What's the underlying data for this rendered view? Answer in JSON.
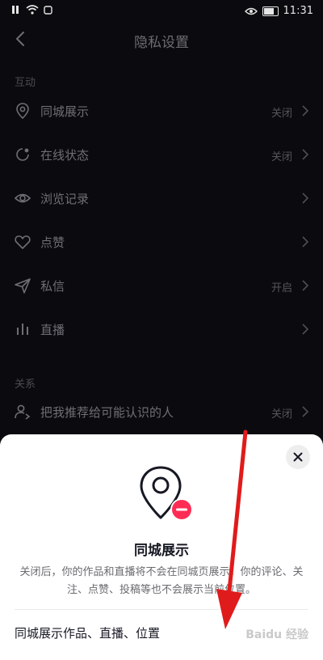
{
  "statusbar": {
    "time": "11:31"
  },
  "header": {
    "title": "隐私设置"
  },
  "sections": {
    "interaction": "互动",
    "relations": "关系"
  },
  "rows": [
    {
      "label": "同城展示",
      "status": "关闭",
      "icon": "location-pin-icon"
    },
    {
      "label": "在线状态",
      "status": "关闭",
      "icon": "online-status-icon"
    },
    {
      "label": "浏览记录",
      "status": "",
      "icon": "eye-icon"
    },
    {
      "label": "点赞",
      "status": "",
      "icon": "heart-icon"
    },
    {
      "label": "私信",
      "status": "开启",
      "icon": "send-icon"
    },
    {
      "label": "直播",
      "status": "",
      "icon": "live-bars-icon"
    },
    {
      "label": "把我推荐给可能认识的人",
      "status": "关闭",
      "icon": "person-recommend-icon"
    }
  ],
  "sheet": {
    "title": "同城展示",
    "description": "关闭后，你的作品和直播将不会在同城页展示，你的评论、关注、点赞、投稿等也不会展示当前位置。",
    "item": "同城展示作品、直播、位置",
    "watermark": "Baidu 经验"
  },
  "colors": {
    "accent": "#fe2c55",
    "arrow": "#e01b1b"
  }
}
